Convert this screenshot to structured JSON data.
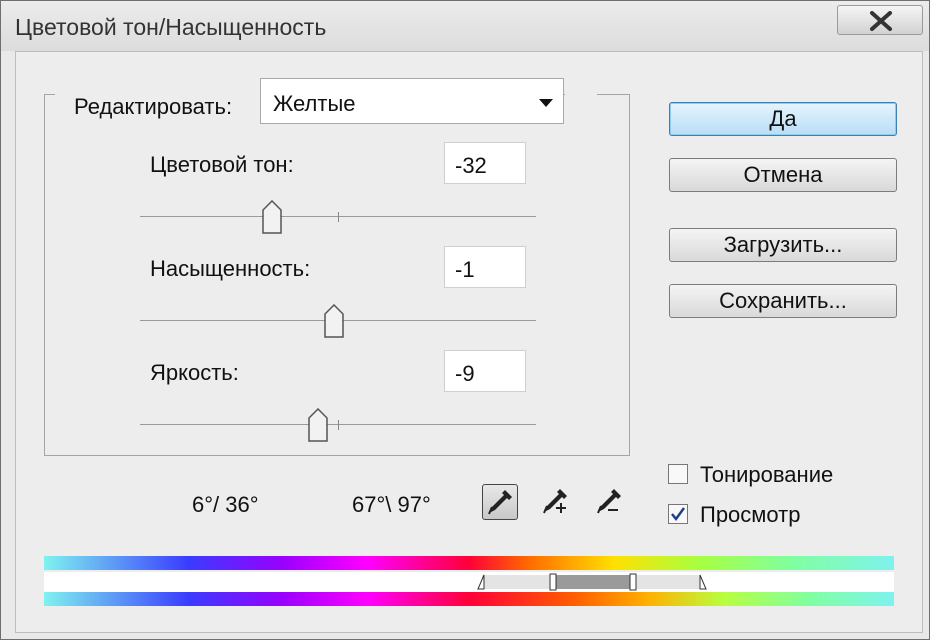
{
  "window": {
    "title": "Цветовой тон/Насыщенность"
  },
  "edit": {
    "label": "Редактировать:",
    "value": "Желтые"
  },
  "sliders": [
    {
      "label": "Цветовой тон:",
      "value": "-32"
    },
    {
      "label": "Насыщенность:",
      "value": "-1"
    },
    {
      "label": "Яркость:",
      "value": "-9"
    }
  ],
  "buttons": {
    "ok": "Да",
    "cancel": "Отмена",
    "load": "Загрузить...",
    "save": "Сохранить..."
  },
  "range": {
    "left": "6°/ 36°",
    "right": "67°\\ 97°"
  },
  "options": {
    "colorize": {
      "label": "Тонирование",
      "checked": false
    },
    "preview": {
      "label": "Просмотр",
      "checked": true
    }
  },
  "icons": {
    "eyedropper": "eyedropper-icon",
    "eyedropper_plus": "eyedropper-plus-icon",
    "eyedropper_minus": "eyedropper-minus-icon"
  },
  "colors": {
    "default_button": "#b8def6",
    "range_fill": "#9a9a9a"
  }
}
